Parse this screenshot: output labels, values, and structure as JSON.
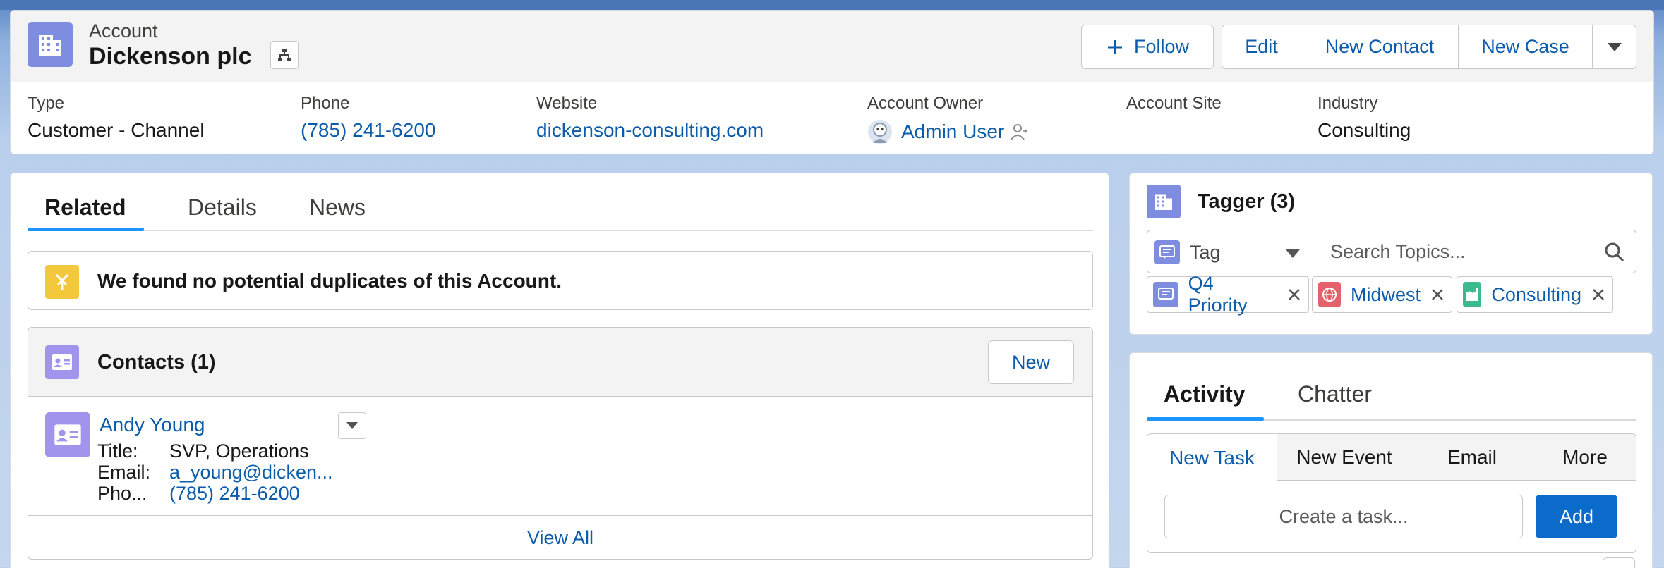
{
  "header": {
    "object_label": "Account",
    "record_name": "Dickenson plc",
    "actions": {
      "follow": "Follow",
      "edit": "Edit",
      "new_contact": "New Contact",
      "new_case": "New Case"
    },
    "fields": {
      "type": {
        "label": "Type",
        "value": "Customer - Channel"
      },
      "phone": {
        "label": "Phone",
        "value": "(785) 241-6200"
      },
      "website": {
        "label": "Website",
        "value": "dickenson-consulting.com"
      },
      "owner": {
        "label": "Account Owner",
        "value": "Admin User"
      },
      "site": {
        "label": "Account Site",
        "value": ""
      },
      "industry": {
        "label": "Industry",
        "value": "Consulting"
      }
    }
  },
  "main": {
    "tabs": {
      "related": "Related",
      "details": "Details",
      "news": "News"
    },
    "duplicates_message": "We found no potential duplicates of this Account.",
    "contacts": {
      "title": "Contacts (1)",
      "new_label": "New",
      "view_all": "View All",
      "items": [
        {
          "name": "Andy Young",
          "title_label": "Title:",
          "title": "SVP, Operations",
          "email_label": "Email:",
          "email": "a_young@dicken...",
          "phone_label": "Pho...",
          "phone": "(785) 241-6200"
        }
      ]
    }
  },
  "tagger": {
    "title": "Tagger (3)",
    "select_value": "Tag",
    "search_placeholder": "Search Topics...",
    "tags": [
      {
        "label": "Q4 Priority",
        "color": "#7f8de1"
      },
      {
        "label": "Midwest",
        "color": "#e4626b"
      },
      {
        "label": "Consulting",
        "color": "#3dba8c"
      }
    ]
  },
  "activity": {
    "tabs": {
      "activity": "Activity",
      "chatter": "Chatter"
    },
    "publisher_tabs": {
      "new_task": "New Task",
      "new_event": "New Event",
      "email": "Email",
      "more": "More"
    },
    "task_placeholder": "Create a task...",
    "add_label": "Add"
  },
  "colors": {
    "link": "#0b5cab",
    "brand_button": "#0b6bcb",
    "tab_indicator": "#1b96ff",
    "account_icon": "#7f8de1",
    "contact_icon": "#a094ed",
    "duplicate_icon": "#f4c83c"
  }
}
